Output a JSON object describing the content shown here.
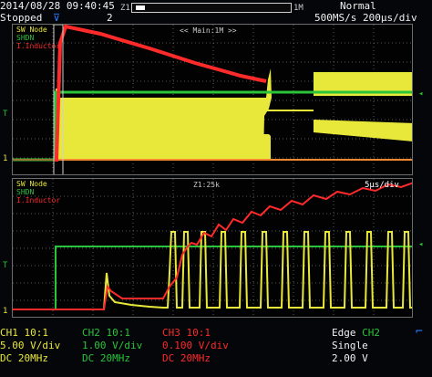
{
  "header": {
    "datetime": "2014/08/28 09:40:45",
    "run_state": "Stopped",
    "acq_count": "2",
    "zoom_left_marker": "Z1",
    "zoom_right_marker": "1M",
    "trigger_mode": "Normal",
    "timebase": "500MS/s 200μs/div"
  },
  "upper_panel": {
    "legend": [
      "SW Node",
      "SHDN",
      "I.Inductor"
    ],
    "zoom_label": "<< Main:1M >>"
  },
  "lower_panel": {
    "legend": [
      "SW Node",
      "SHDN",
      "I.Inductor"
    ],
    "zoom_label": "Z1:25k",
    "timebase": "5μs/div"
  },
  "channels": [
    {
      "name": "CH1",
      "probe": "10:1",
      "scale": "5.00 V/div",
      "coupling": "DC",
      "bw": "20MHz",
      "color": "#e8e83a"
    },
    {
      "name": "CH2",
      "probe": "10:1",
      "scale": "1.00 V/div",
      "coupling": "DC",
      "bw": "20MHz",
      "color": "#29c43a"
    },
    {
      "name": "CH3",
      "probe": "10:1",
      "scale": "0.100 V/div",
      "coupling": "DC",
      "bw": "20MHz",
      "color": "#ff2a2a"
    }
  ],
  "trigger": {
    "type": "Edge",
    "source": "CH2",
    "mode": "Single",
    "level": "2.00 V"
  },
  "colors": {
    "ch1": "#e8e83a",
    "ch2": "#29c43a",
    "ch3": "#ff2a2a",
    "ui_accent": "#2b7bff"
  },
  "icons": {
    "trigger_slope": "rising-edge-icon",
    "trigger_marker": "trigger-position-icon",
    "zoom_mark": "zoom-window-icon"
  }
}
